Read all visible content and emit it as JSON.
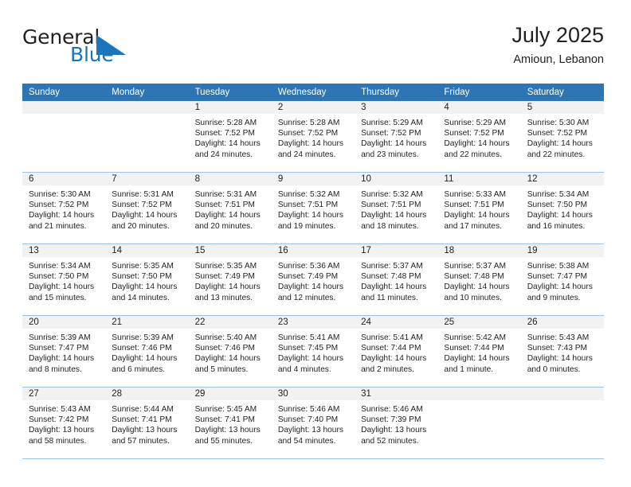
{
  "brand": {
    "name_part1": "General",
    "name_part2": "Blue",
    "flag_icon": "triangle-flag-icon",
    "accent_color": "#1b75bb"
  },
  "header": {
    "title": "July 2025",
    "subtitle": "Amioun, Lebanon"
  },
  "calendar": {
    "header_bg": "#2e75b6",
    "row_divider": "#9dc3e6",
    "daynum_bg": "#f2f2f2",
    "weekdays": [
      "Sunday",
      "Monday",
      "Tuesday",
      "Wednesday",
      "Thursday",
      "Friday",
      "Saturday"
    ],
    "weeks": [
      [
        {
          "day": "",
          "empty": true
        },
        {
          "day": "",
          "empty": true
        },
        {
          "day": "1",
          "sunrise": "Sunrise: 5:28 AM",
          "sunset": "Sunset: 7:52 PM",
          "daylight": "Daylight: 14 hours and 24 minutes."
        },
        {
          "day": "2",
          "sunrise": "Sunrise: 5:28 AM",
          "sunset": "Sunset: 7:52 PM",
          "daylight": "Daylight: 14 hours and 24 minutes."
        },
        {
          "day": "3",
          "sunrise": "Sunrise: 5:29 AM",
          "sunset": "Sunset: 7:52 PM",
          "daylight": "Daylight: 14 hours and 23 minutes."
        },
        {
          "day": "4",
          "sunrise": "Sunrise: 5:29 AM",
          "sunset": "Sunset: 7:52 PM",
          "daylight": "Daylight: 14 hours and 22 minutes."
        },
        {
          "day": "5",
          "sunrise": "Sunrise: 5:30 AM",
          "sunset": "Sunset: 7:52 PM",
          "daylight": "Daylight: 14 hours and 22 minutes."
        }
      ],
      [
        {
          "day": "6",
          "sunrise": "Sunrise: 5:30 AM",
          "sunset": "Sunset: 7:52 PM",
          "daylight": "Daylight: 14 hours and 21 minutes."
        },
        {
          "day": "7",
          "sunrise": "Sunrise: 5:31 AM",
          "sunset": "Sunset: 7:52 PM",
          "daylight": "Daylight: 14 hours and 20 minutes."
        },
        {
          "day": "8",
          "sunrise": "Sunrise: 5:31 AM",
          "sunset": "Sunset: 7:51 PM",
          "daylight": "Daylight: 14 hours and 20 minutes."
        },
        {
          "day": "9",
          "sunrise": "Sunrise: 5:32 AM",
          "sunset": "Sunset: 7:51 PM",
          "daylight": "Daylight: 14 hours and 19 minutes."
        },
        {
          "day": "10",
          "sunrise": "Sunrise: 5:32 AM",
          "sunset": "Sunset: 7:51 PM",
          "daylight": "Daylight: 14 hours and 18 minutes."
        },
        {
          "day": "11",
          "sunrise": "Sunrise: 5:33 AM",
          "sunset": "Sunset: 7:51 PM",
          "daylight": "Daylight: 14 hours and 17 minutes."
        },
        {
          "day": "12",
          "sunrise": "Sunrise: 5:34 AM",
          "sunset": "Sunset: 7:50 PM",
          "daylight": "Daylight: 14 hours and 16 minutes."
        }
      ],
      [
        {
          "day": "13",
          "sunrise": "Sunrise: 5:34 AM",
          "sunset": "Sunset: 7:50 PM",
          "daylight": "Daylight: 14 hours and 15 minutes."
        },
        {
          "day": "14",
          "sunrise": "Sunrise: 5:35 AM",
          "sunset": "Sunset: 7:50 PM",
          "daylight": "Daylight: 14 hours and 14 minutes."
        },
        {
          "day": "15",
          "sunrise": "Sunrise: 5:35 AM",
          "sunset": "Sunset: 7:49 PM",
          "daylight": "Daylight: 14 hours and 13 minutes."
        },
        {
          "day": "16",
          "sunrise": "Sunrise: 5:36 AM",
          "sunset": "Sunset: 7:49 PM",
          "daylight": "Daylight: 14 hours and 12 minutes."
        },
        {
          "day": "17",
          "sunrise": "Sunrise: 5:37 AM",
          "sunset": "Sunset: 7:48 PM",
          "daylight": "Daylight: 14 hours and 11 minutes."
        },
        {
          "day": "18",
          "sunrise": "Sunrise: 5:37 AM",
          "sunset": "Sunset: 7:48 PM",
          "daylight": "Daylight: 14 hours and 10 minutes."
        },
        {
          "day": "19",
          "sunrise": "Sunrise: 5:38 AM",
          "sunset": "Sunset: 7:47 PM",
          "daylight": "Daylight: 14 hours and 9 minutes."
        }
      ],
      [
        {
          "day": "20",
          "sunrise": "Sunrise: 5:39 AM",
          "sunset": "Sunset: 7:47 PM",
          "daylight": "Daylight: 14 hours and 8 minutes."
        },
        {
          "day": "21",
          "sunrise": "Sunrise: 5:39 AM",
          "sunset": "Sunset: 7:46 PM",
          "daylight": "Daylight: 14 hours and 6 minutes."
        },
        {
          "day": "22",
          "sunrise": "Sunrise: 5:40 AM",
          "sunset": "Sunset: 7:46 PM",
          "daylight": "Daylight: 14 hours and 5 minutes."
        },
        {
          "day": "23",
          "sunrise": "Sunrise: 5:41 AM",
          "sunset": "Sunset: 7:45 PM",
          "daylight": "Daylight: 14 hours and 4 minutes."
        },
        {
          "day": "24",
          "sunrise": "Sunrise: 5:41 AM",
          "sunset": "Sunset: 7:44 PM",
          "daylight": "Daylight: 14 hours and 2 minutes."
        },
        {
          "day": "25",
          "sunrise": "Sunrise: 5:42 AM",
          "sunset": "Sunset: 7:44 PM",
          "daylight": "Daylight: 14 hours and 1 minute."
        },
        {
          "day": "26",
          "sunrise": "Sunrise: 5:43 AM",
          "sunset": "Sunset: 7:43 PM",
          "daylight": "Daylight: 14 hours and 0 minutes."
        }
      ],
      [
        {
          "day": "27",
          "sunrise": "Sunrise: 5:43 AM",
          "sunset": "Sunset: 7:42 PM",
          "daylight": "Daylight: 13 hours and 58 minutes."
        },
        {
          "day": "28",
          "sunrise": "Sunrise: 5:44 AM",
          "sunset": "Sunset: 7:41 PM",
          "daylight": "Daylight: 13 hours and 57 minutes."
        },
        {
          "day": "29",
          "sunrise": "Sunrise: 5:45 AM",
          "sunset": "Sunset: 7:41 PM",
          "daylight": "Daylight: 13 hours and 55 minutes."
        },
        {
          "day": "30",
          "sunrise": "Sunrise: 5:46 AM",
          "sunset": "Sunset: 7:40 PM",
          "daylight": "Daylight: 13 hours and 54 minutes."
        },
        {
          "day": "31",
          "sunrise": "Sunrise: 5:46 AM",
          "sunset": "Sunset: 7:39 PM",
          "daylight": "Daylight: 13 hours and 52 minutes."
        },
        {
          "day": "",
          "empty": true
        },
        {
          "day": "",
          "empty": true
        }
      ]
    ]
  }
}
